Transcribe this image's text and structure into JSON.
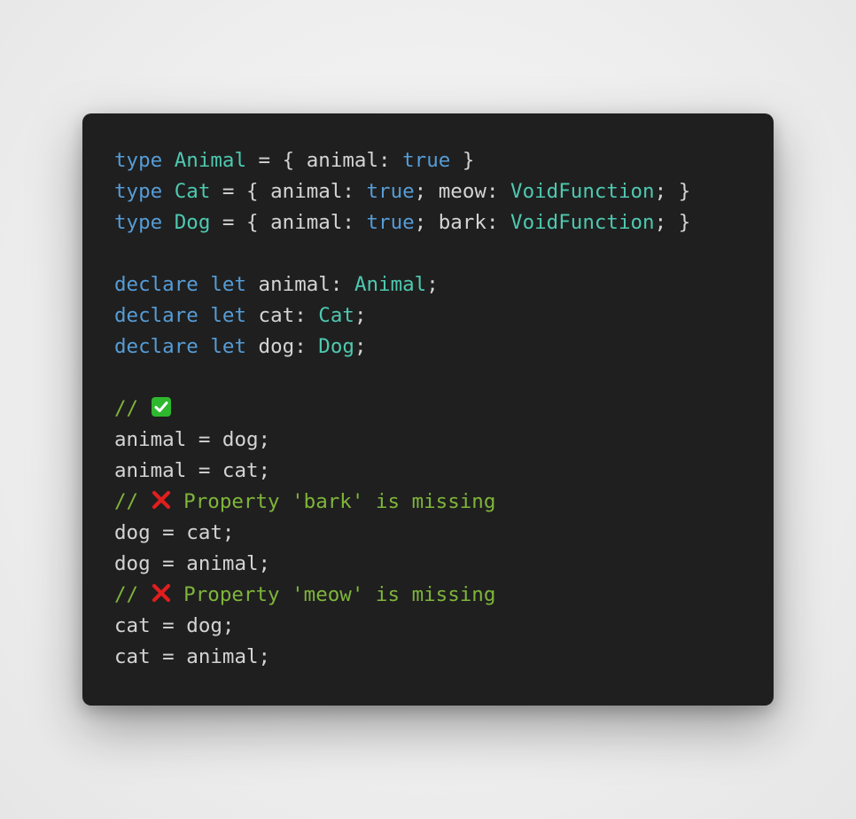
{
  "colors": {
    "background": "#eeeeee",
    "editor_background": "#1f1f1f",
    "keyword": "#569cd6",
    "type": "#4ec9b0",
    "plain": "#d4d4d4",
    "comment": "#7fb53a",
    "check_icon": "#2eb82e",
    "cross_icon": "#e01e1e"
  },
  "lines": [
    [
      {
        "t": "type",
        "c": "kw"
      },
      {
        "t": " ",
        "c": "pl"
      },
      {
        "t": "Animal",
        "c": "ty"
      },
      {
        "t": " = { animal: ",
        "c": "pl"
      },
      {
        "t": "true",
        "c": "kw"
      },
      {
        "t": " }",
        "c": "pl"
      }
    ],
    [
      {
        "t": "type",
        "c": "kw"
      },
      {
        "t": " ",
        "c": "pl"
      },
      {
        "t": "Cat",
        "c": "ty"
      },
      {
        "t": " = { animal: ",
        "c": "pl"
      },
      {
        "t": "true",
        "c": "kw"
      },
      {
        "t": "; meow: ",
        "c": "pl"
      },
      {
        "t": "VoidFunction",
        "c": "ty"
      },
      {
        "t": "; }",
        "c": "pl"
      }
    ],
    [
      {
        "t": "type",
        "c": "kw"
      },
      {
        "t": " ",
        "c": "pl"
      },
      {
        "t": "Dog",
        "c": "ty"
      },
      {
        "t": " = { animal: ",
        "c": "pl"
      },
      {
        "t": "true",
        "c": "kw"
      },
      {
        "t": "; bark: ",
        "c": "pl"
      },
      {
        "t": "VoidFunction",
        "c": "ty"
      },
      {
        "t": "; }",
        "c": "pl"
      }
    ],
    [],
    [
      {
        "t": "declare",
        "c": "kw"
      },
      {
        "t": " ",
        "c": "pl"
      },
      {
        "t": "let",
        "c": "kw"
      },
      {
        "t": " animal: ",
        "c": "pl"
      },
      {
        "t": "Animal",
        "c": "ty"
      },
      {
        "t": ";",
        "c": "pl"
      }
    ],
    [
      {
        "t": "declare",
        "c": "kw"
      },
      {
        "t": " ",
        "c": "pl"
      },
      {
        "t": "let",
        "c": "kw"
      },
      {
        "t": " cat: ",
        "c": "pl"
      },
      {
        "t": "Cat",
        "c": "ty"
      },
      {
        "t": ";",
        "c": "pl"
      }
    ],
    [
      {
        "t": "declare",
        "c": "kw"
      },
      {
        "t": " ",
        "c": "pl"
      },
      {
        "t": "let",
        "c": "kw"
      },
      {
        "t": " dog: ",
        "c": "pl"
      },
      {
        "t": "Dog",
        "c": "ty"
      },
      {
        "t": ";",
        "c": "pl"
      }
    ],
    [],
    [
      {
        "t": "// ",
        "c": "cm"
      },
      {
        "icon": "check-mark-icon"
      }
    ],
    [
      {
        "t": "animal = dog;",
        "c": "pl"
      }
    ],
    [
      {
        "t": "animal = cat;",
        "c": "pl"
      }
    ],
    [
      {
        "t": "// ",
        "c": "cm"
      },
      {
        "icon": "cross-mark-icon"
      },
      {
        "t": " Property 'bark' is missing",
        "c": "cm"
      }
    ],
    [
      {
        "t": "dog = cat;",
        "c": "pl"
      }
    ],
    [
      {
        "t": "dog = animal;",
        "c": "pl"
      }
    ],
    [
      {
        "t": "// ",
        "c": "cm"
      },
      {
        "icon": "cross-mark-icon"
      },
      {
        "t": " Property 'meow' is missing",
        "c": "cm"
      }
    ],
    [
      {
        "t": "cat = dog;",
        "c": "pl"
      }
    ],
    [
      {
        "t": "cat = animal;",
        "c": "pl"
      }
    ]
  ]
}
